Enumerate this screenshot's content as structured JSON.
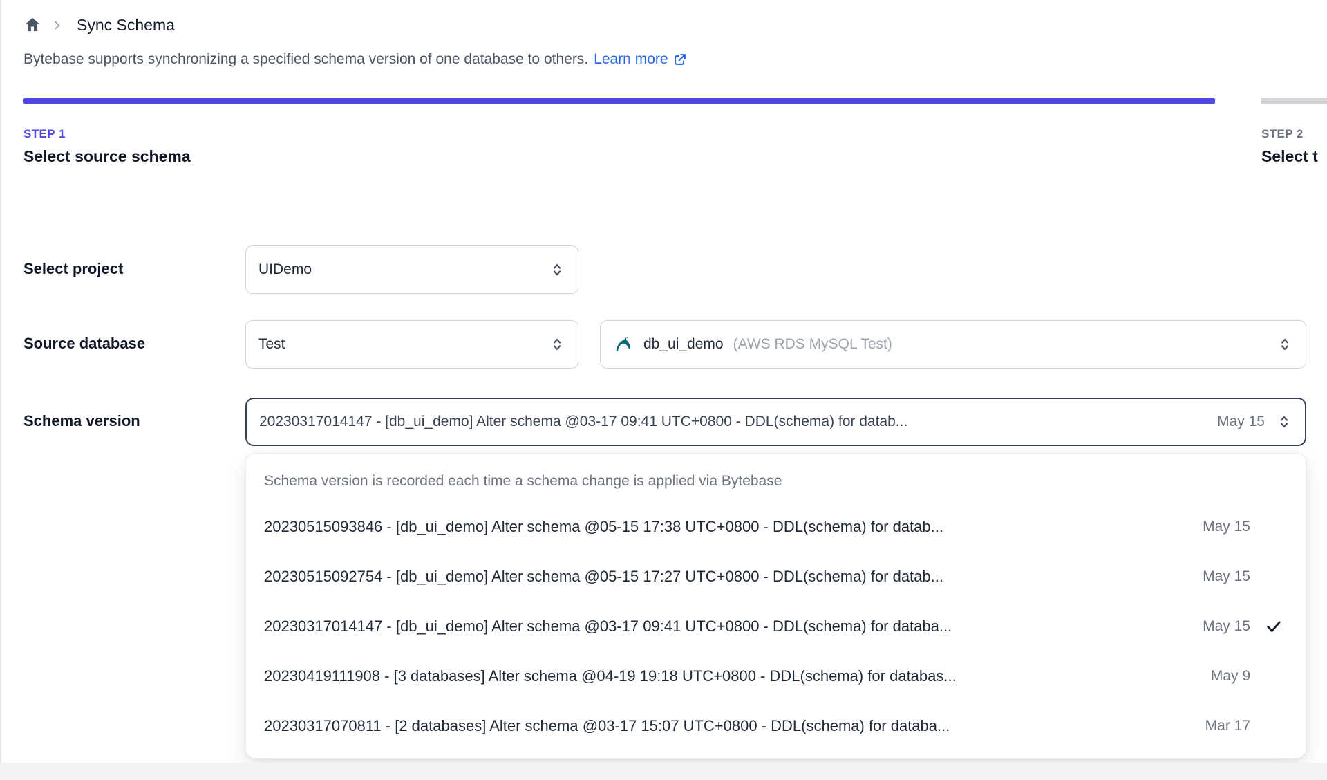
{
  "breadcrumb": {
    "current": "Sync Schema"
  },
  "description": {
    "text": "Bytebase supports synchronizing a specified schema version of one database to others.",
    "link_label": "Learn more"
  },
  "steps": [
    {
      "label": "STEP 1",
      "title": "Select source schema",
      "state": "active"
    },
    {
      "label": "STEP 2",
      "title": "Select t",
      "state": "upcoming"
    }
  ],
  "form": {
    "project": {
      "label": "Select project",
      "value": "UIDemo"
    },
    "source_database": {
      "label": "Source database",
      "environment_value": "Test",
      "database_value": "db_ui_demo",
      "database_detail": "(AWS RDS MySQL Test)"
    },
    "schema_version": {
      "label": "Schema version",
      "value": "20230317014147 - [db_ui_demo] Alter schema @03-17 09:41 UTC+0800 - DDL(schema) for datab...",
      "date": "May 15"
    }
  },
  "dropdown": {
    "header": "Schema version is recorded each time a schema change is applied via Bytebase",
    "options": [
      {
        "text": "20230515093846 - [db_ui_demo] Alter schema @05-15 17:38 UTC+0800 - DDL(schema) for datab...",
        "date": "May 15",
        "selected": false
      },
      {
        "text": "20230515092754 - [db_ui_demo] Alter schema @05-15 17:27 UTC+0800 - DDL(schema) for datab...",
        "date": "May 15",
        "selected": false
      },
      {
        "text": "20230317014147 - [db_ui_demo] Alter schema @03-17 09:41 UTC+0800 - DDL(schema) for databa...",
        "date": "May 15",
        "selected": true
      },
      {
        "text": "20230419111908 - [3 databases] Alter schema @04-19 19:18 UTC+0800 - DDL(schema) for databas...",
        "date": "May 9",
        "selected": false
      },
      {
        "text": "20230317070811 - [2 databases] Alter schema @03-17 15:07 UTC+0800 - DDL(schema) for databa...",
        "date": "Mar 17",
        "selected": false
      }
    ]
  },
  "colors": {
    "accent_indigo": "#4f46e5",
    "link_blue": "#2563eb",
    "inactive_bar_gray": "#d4d4d8",
    "mysql_teal": "#00687b"
  }
}
